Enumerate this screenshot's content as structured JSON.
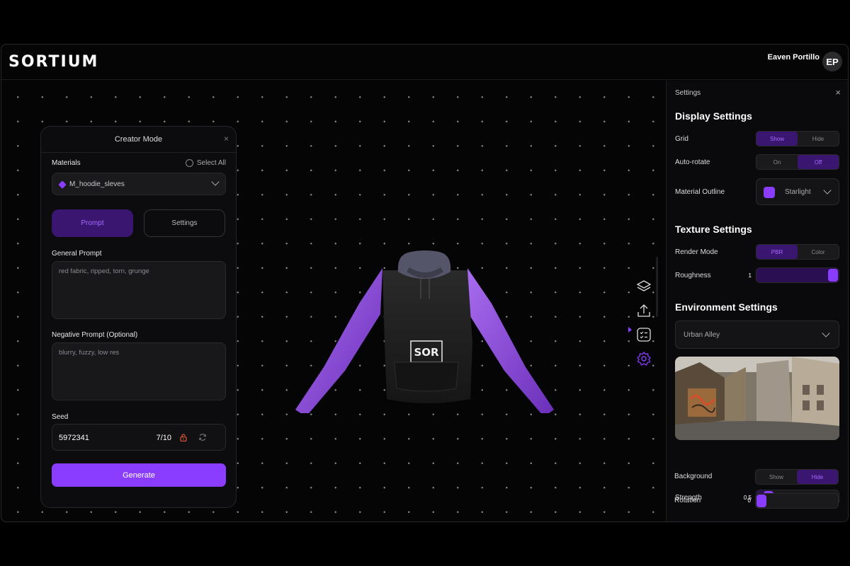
{
  "brand": {
    "logo": "SORTIUM",
    "accent": "#8b3dff"
  },
  "user": {
    "name": "Eaven Portillo",
    "initials": "EP"
  },
  "creator": {
    "title": "Creator Mode",
    "close": "×",
    "materials_label": "Materials",
    "select_all": "Select All",
    "material_value": "M_hoodie_sleves",
    "tabs": [
      {
        "label": "Prompt",
        "active": true
      },
      {
        "label": "Settings",
        "active": false
      }
    ],
    "general_prompt_label": "General Prompt",
    "general_prompt_value": "red fabric, ripped, torn, grunge",
    "negative_prompt_label": "Negative Prompt (Optional)",
    "negative_prompt_value": "blurry, fuzzy, low res",
    "seed_label": "Seed",
    "seed_value": "5972341",
    "seed_count": "7/10",
    "generate_label": "Generate"
  },
  "model": {
    "logo_text": "SOR"
  },
  "toolbar": {
    "icons": [
      "layers-icon",
      "upload-icon",
      "checklist-icon",
      "settings-gear-icon"
    ],
    "active": "settings-gear-icon"
  },
  "settings": {
    "header": "Settings",
    "close": "×",
    "display_title": "Display Settings",
    "grid_label": "Grid",
    "grid_options": [
      "Show",
      "Hide"
    ],
    "grid_selected": "Show",
    "autorotate_label": "Auto-rotate",
    "autorotate_options": [
      "On",
      "Off"
    ],
    "autorotate_selected": "Off",
    "outline_label": "Material Outline",
    "outline_value": "Starlight",
    "outline_color": "#8b3dff",
    "texture_title": "Texture Settings",
    "render_label": "Render Mode",
    "render_options": [
      "PBR",
      "Color"
    ],
    "render_selected": "PBR",
    "roughness_label": "Roughness",
    "roughness_value": "1",
    "environment_title": "Environment Settings",
    "environment_value": "Urban Alley",
    "strength_label": "Strength",
    "strength_value": "0.5",
    "background_label": "Background",
    "background_options": [
      "Show",
      "Hide"
    ],
    "background_selected": "Hide",
    "rotation_label": "Rotation",
    "rotation_value": "0"
  }
}
